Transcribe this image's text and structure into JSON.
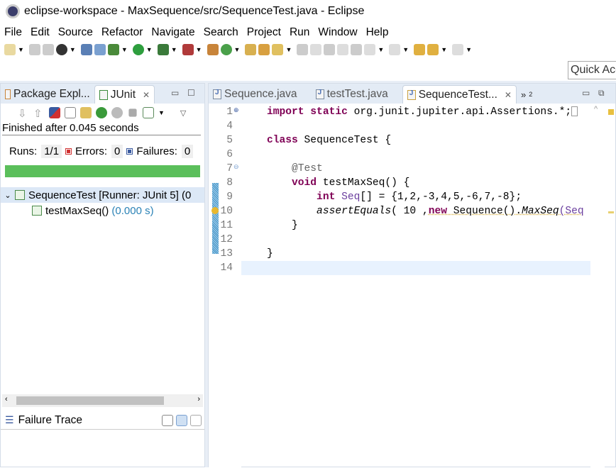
{
  "window": {
    "title": "eclipse-workspace - MaxSequence/src/SequenceTest.java - Eclipse"
  },
  "menu": [
    "File",
    "Edit",
    "Source",
    "Refactor",
    "Navigate",
    "Search",
    "Project",
    "Run",
    "Window",
    "Help"
  ],
  "quick_access": {
    "placeholder": "Quick Access"
  },
  "left_panel": {
    "tabs": [
      {
        "label": "Package Expl..."
      },
      {
        "label": "JUnit",
        "active": true
      }
    ],
    "status": "Finished after 0.045 seconds",
    "runs_label": "Runs:",
    "runs": "1/1",
    "errors_label": "Errors:",
    "errors": "0",
    "failures_label": "Failures:",
    "failures": "0",
    "progress": 1.0,
    "progress_color": "#5bbf5b",
    "tree": [
      {
        "label": "SequenceTest [Runner: JUnit 5] (0",
        "time": ""
      },
      {
        "label": "testMaxSeq()",
        "time": "(0.000 s)"
      }
    ],
    "failure_trace": "Failure Trace"
  },
  "editor": {
    "tabs": [
      {
        "label": "Sequence.java"
      },
      {
        "label": "testTest.java"
      },
      {
        "label": "SequenceTest...",
        "active": true
      }
    ],
    "overflow": "»",
    "overflow_count": "2",
    "line_numbers": [
      "1",
      "4",
      "5",
      "6",
      "7",
      "8",
      "9",
      "10",
      "11",
      "12",
      "13",
      "14"
    ],
    "lines": {
      "l1a": "import static",
      "l1b": " org.junit.jupiter.api.Assertions.*;",
      "l5a": "class",
      "l5b": " SequenceTest {",
      "l7": "    @Test",
      "l8a": "    void",
      "l8b": " testMaxSeq() {",
      "l9a": "        int",
      "l9b": " Seq",
      "l9c": "[] = {1,2,-3,4,5,-6,7,-8};",
      "l10a": "        assertEquals",
      "l10b": "( 10 ,",
      "l10c": "new",
      "l10d": " Sequence().",
      "l10e": "MaxSeq",
      "l10f": "(Seq",
      "l11": "    }",
      "l13": "}"
    }
  }
}
